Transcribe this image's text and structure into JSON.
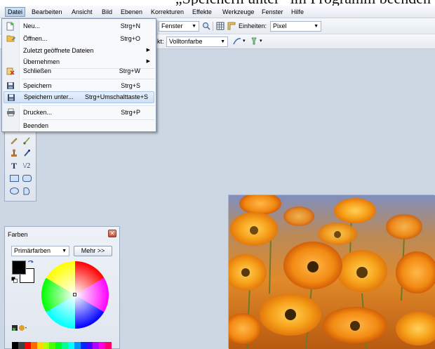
{
  "caption": {
    "text": "„Speichern unter“ im Programm beenden"
  },
  "menubar": {
    "items": [
      "Datei",
      "Bearbeiten",
      "Ansicht",
      "Bild",
      "Ebenen",
      "Korrekturen",
      "Effekte",
      "Werkzeuge",
      "Fenster",
      "Hilfe"
    ],
    "active": "Datei"
  },
  "toolbar": {
    "zoom_value": "Fenster",
    "units_label": "Einheiten:",
    "units_value": "Pixel",
    "fill_label_partial": "kt:",
    "fill_value": "Volltonfarbe"
  },
  "file_menu": {
    "items": [
      {
        "label": "Neu...",
        "shortcut": "Strg+N",
        "icon": "new-document-icon"
      },
      {
        "label": "Öffnen...",
        "shortcut": "Strg+O",
        "icon": "open-folder-icon"
      },
      {
        "label": "Zuletzt geöffnete Dateien",
        "shortcut": "",
        "submenu": true
      },
      {
        "label": "Übernehmen",
        "shortcut": "",
        "submenu": true
      },
      {
        "label": "Schließen",
        "shortcut": "Strg+W",
        "icon": "close-document-icon"
      },
      {
        "label": "Speichern",
        "shortcut": "Strg+S",
        "icon": "save-icon"
      },
      {
        "label": "Speichern unter...",
        "shortcut": "Strg+Umschalttaste+S",
        "icon": "save-as-icon",
        "highlighted": true
      },
      {
        "label": "Drucken...",
        "shortcut": "Strg+P",
        "icon": "printer-icon"
      },
      {
        "label": "Beenden",
        "shortcut": ""
      }
    ],
    "submenu_arrow": "▶"
  },
  "colors_panel": {
    "title": "Farben",
    "palette_select": "Primärfarben",
    "more_button": "Mehr >>",
    "primary_color": "#000000",
    "secondary_color": "#ffffff"
  },
  "tools": [
    "T",
    "\\/2"
  ],
  "icons": [
    "zoom-icon",
    "grid-icon",
    "ruler-icon",
    "pencil-icon",
    "brush-icon",
    "clone-stamp-icon",
    "recolor-icon",
    "text-tool-icon",
    "line-tool-icon",
    "rectangle-tool-icon",
    "rounded-rectangle-tool-icon",
    "ellipse-tool-icon",
    "freeform-tool-icon",
    "swap-colors-icon",
    "reset-colors-icon"
  ],
  "colors": {
    "accent": "#3a6fb0",
    "workspace": "#cdd7e3",
    "highlight": "#cde0f6"
  }
}
